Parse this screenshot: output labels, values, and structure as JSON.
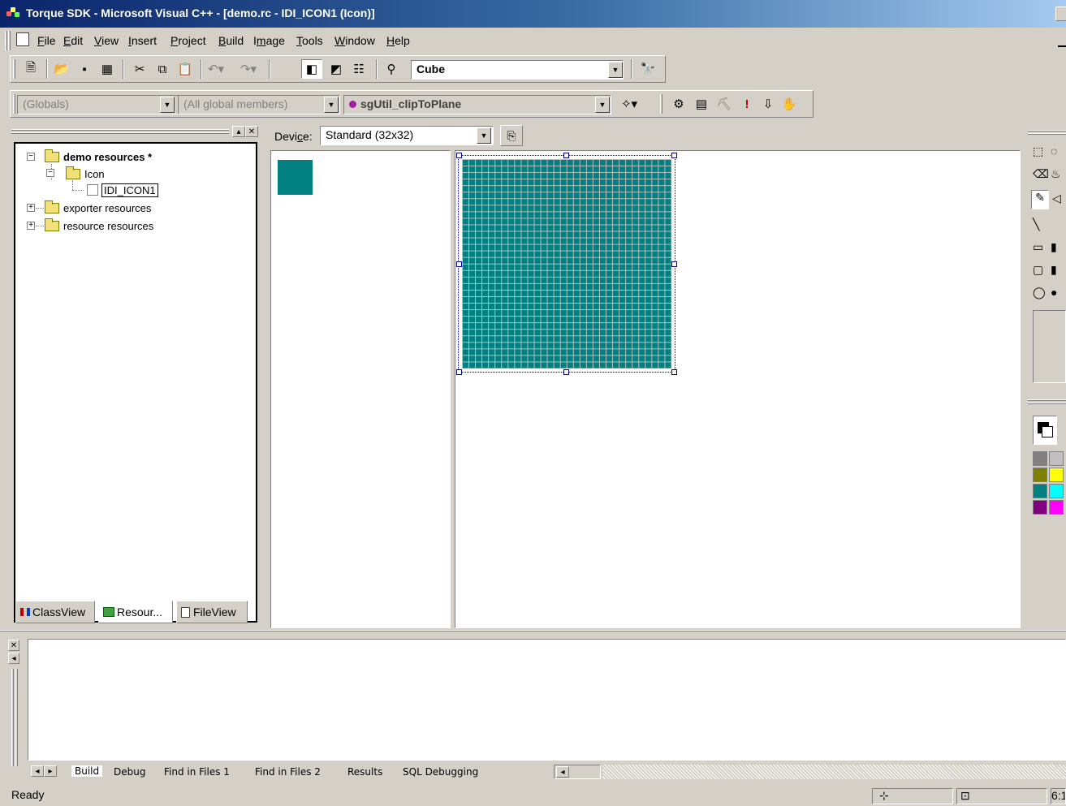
{
  "window": {
    "title": "Torque SDK - Microsoft Visual C++ - [demo.rc - IDI_ICON1 (Icon)]"
  },
  "menu": [
    {
      "label": "File",
      "u": "F",
      "rest": "ile"
    },
    {
      "label": "Edit",
      "u": "E",
      "rest": "dit"
    },
    {
      "label": "View",
      "u": "V",
      "rest": "iew"
    },
    {
      "label": "Insert",
      "u": "I",
      "rest": "nsert"
    },
    {
      "label": "Project",
      "u": "P",
      "rest": "roject"
    },
    {
      "label": "Build",
      "u": "B",
      "rest": "uild"
    },
    {
      "label": "Image",
      "pre": "I",
      "u": "m",
      "rest": "age"
    },
    {
      "label": "Tools",
      "u": "T",
      "rest": "ools"
    },
    {
      "label": "Window",
      "u": "W",
      "rest": "indow"
    },
    {
      "label": "Help",
      "u": "H",
      "rest": "elp"
    }
  ],
  "toolbar": {
    "find_value": "Cube",
    "globals_value": "(Globals)",
    "members_value": "(All global members)",
    "function_value": "sgUtil_clipToPlane",
    "exclaim": "!"
  },
  "workspace": {
    "tree": {
      "root": "demo resources *",
      "icon_folder": "Icon",
      "icon_item": "IDI_ICON1",
      "exporter": "exporter resources",
      "resource": "resource resources"
    },
    "tabs": {
      "classview": "ClassView",
      "resource": "Resour...",
      "fileview": "FileView"
    }
  },
  "editor": {
    "device_label_pre": "Devi",
    "device_label_u": "c",
    "device_label_post": "e:",
    "device_value": "Standard (32x32)",
    "icon_color": "#008080"
  },
  "palette": {
    "colors": [
      "#808080",
      "#c0c0c0",
      "#808000",
      "#ffff00",
      "#008080",
      "#00ffff",
      "#800080",
      "#ff00ff"
    ]
  },
  "output": {
    "tabs": [
      "Build",
      "Debug",
      "Find in Files 1",
      "Find in Files 2",
      "Results",
      "SQL Debugging"
    ]
  },
  "status": {
    "text": "Ready",
    "position": "6:1"
  }
}
